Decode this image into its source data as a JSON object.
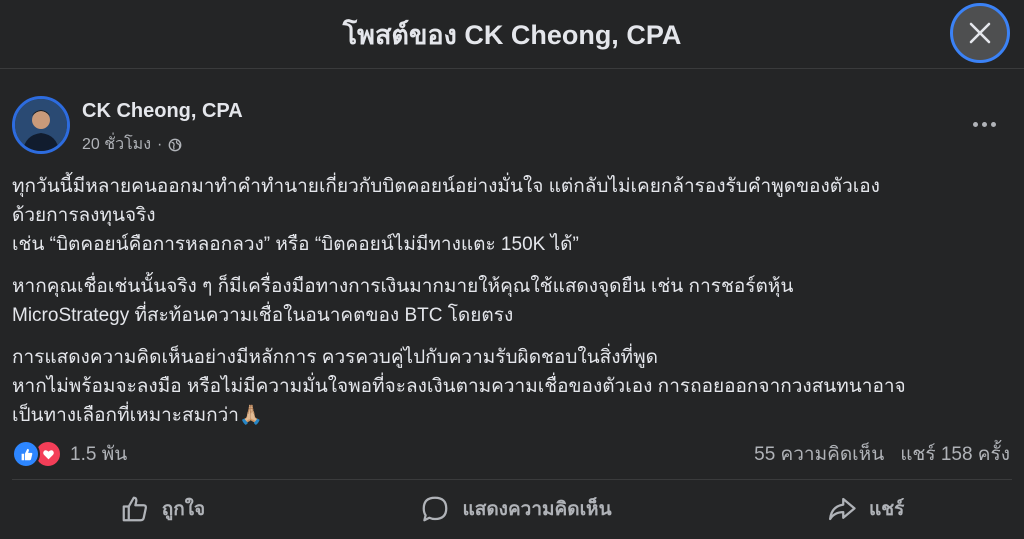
{
  "header": {
    "title": "โพสต์ของ CK Cheong, CPA"
  },
  "post": {
    "author": "CK Cheong, CPA",
    "time": "20 ชั่วโมง",
    "separator": "·",
    "paragraphs": [
      [
        "ทุกวันนี้มีหลายคนออกมาทำคำทำนายเกี่ยวกับบิตคอยน์อย่างมั่นใจ แต่กลับไม่เคยกล้ารองรับคำพูดของตัวเอง",
        "ด้วยการลงทุนจริง",
        "เช่น “บิตคอยน์คือการหลอกลวง” หรือ “บิตคอยน์ไม่มีทางแตะ 150K ได้”"
      ],
      [
        "หากคุณเชื่อเช่นนั้นจริง ๆ ก็มีเครื่องมือทางการเงินมากมายให้คุณใช้แสดงจุดยืน เช่น การชอร์ตหุ้น",
        "MicroStrategy ที่สะท้อนความเชื่อในอนาคตของ BTC โดยตรง"
      ],
      [
        "การแสดงความคิดเห็นอย่างมีหลักการ ควรควบคู่ไปกับความรับผิดชอบในสิ่งที่พูด",
        "หากไม่พร้อมจะลงมือ หรือไม่มีความมั่นใจพอที่จะลงเงินตามความเชื่อของตัวเอง การถอยออกจากวงสนทนาอาจ",
        "เป็นทางเลือกที่เหมาะสมกว่า🙏🏼"
      ]
    ]
  },
  "stats": {
    "reactions_count": "1.5 พัน",
    "comments": "55 ความคิดเห็น",
    "shares": "แชร์ 158 ครั้ง"
  },
  "actions": {
    "like": "ถูกใจ",
    "comment": "แสดงความคิดเห็น",
    "share": "แชร์"
  },
  "colors": {
    "background": "#242526",
    "text": "#e4e6eb",
    "secondary": "#b0b3b8",
    "like_blue": "#2d86ff",
    "love_red": "#f33e58"
  }
}
